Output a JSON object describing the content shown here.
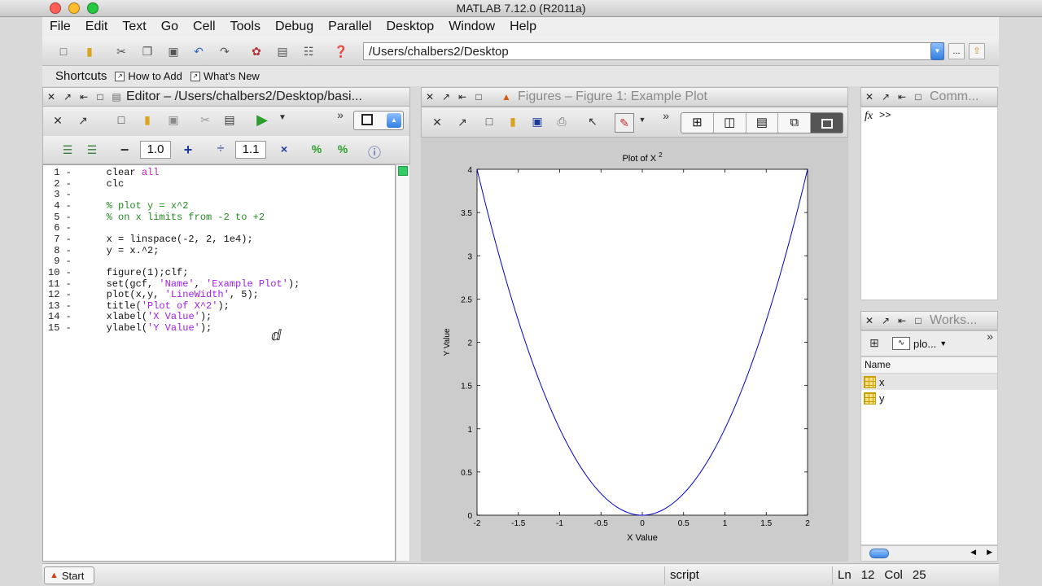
{
  "window": {
    "title": "MATLAB 7.12.0 (R2011a)"
  },
  "menu": [
    "File",
    "Edit",
    "Text",
    "Go",
    "Cell",
    "Tools",
    "Debug",
    "Parallel",
    "Desktop",
    "Window",
    "Help"
  ],
  "toolbar": {
    "current_dir": "/Users/chalbers2/Desktop",
    "browse_label": "..."
  },
  "shortcuts": {
    "label": "Shortcuts",
    "items": [
      "How to Add",
      "What's New"
    ]
  },
  "editor": {
    "title": "Editor – /Users/chalbers2/Desktop/basi...",
    "cell_decrement": "1.0",
    "cell_divide": "1.1",
    "lines": [
      {
        "n": "1",
        "seg": [
          {
            "t": "clear ",
            "c": ""
          },
          {
            "t": "all",
            "c": "kw"
          }
        ]
      },
      {
        "n": "2",
        "seg": [
          {
            "t": "clc",
            "c": ""
          }
        ]
      },
      {
        "n": "3",
        "seg": []
      },
      {
        "n": "4",
        "seg": [
          {
            "t": "% plot y = x^2",
            "c": "cm"
          }
        ]
      },
      {
        "n": "5",
        "seg": [
          {
            "t": "% on x limits from -2 to +2",
            "c": "cm"
          }
        ]
      },
      {
        "n": "6",
        "seg": []
      },
      {
        "n": "7",
        "seg": [
          {
            "t": "x = linspace(-2, 2, 1e4);",
            "c": ""
          }
        ]
      },
      {
        "n": "8",
        "seg": [
          {
            "t": "y = x.^2;",
            "c": ""
          }
        ]
      },
      {
        "n": "9",
        "seg": []
      },
      {
        "n": "10",
        "seg": [
          {
            "t": "figure(1);clf;",
            "c": ""
          }
        ]
      },
      {
        "n": "11",
        "seg": [
          {
            "t": "set(gcf, ",
            "c": ""
          },
          {
            "t": "'Name'",
            "c": "str"
          },
          {
            "t": ", ",
            "c": ""
          },
          {
            "t": "'Example Plot'",
            "c": "str"
          },
          {
            "t": ");",
            "c": ""
          }
        ]
      },
      {
        "n": "12",
        "seg": [
          {
            "t": "plot(x,y, ",
            "c": ""
          },
          {
            "t": "'LineWidth'",
            "c": "str"
          },
          {
            "t": ", 5);",
            "c": ""
          }
        ]
      },
      {
        "n": "13",
        "seg": [
          {
            "t": "title(",
            "c": ""
          },
          {
            "t": "'Plot of X^2'",
            "c": "str"
          },
          {
            "t": ");",
            "c": ""
          }
        ]
      },
      {
        "n": "14",
        "seg": [
          {
            "t": "xlabel(",
            "c": ""
          },
          {
            "t": "'X Value'",
            "c": "str"
          },
          {
            "t": ");",
            "c": ""
          }
        ]
      },
      {
        "n": "15",
        "seg": [
          {
            "t": "ylabel(",
            "c": ""
          },
          {
            "t": "'Y Value'",
            "c": "str"
          },
          {
            "t": ");",
            "c": ""
          }
        ]
      }
    ]
  },
  "figure": {
    "title": "Figures – Figure 1: Example Plot"
  },
  "chart_data": {
    "type": "line",
    "title": "Plot of X",
    "title_superscript": "2",
    "xlabel": "X Value",
    "ylabel": "Y Value",
    "xlim": [
      -2,
      2
    ],
    "ylim": [
      0,
      4
    ],
    "xticks": [
      "-2",
      "-1.5",
      "-1",
      "-0.5",
      "0",
      "0.5",
      "1",
      "1.5",
      "2"
    ],
    "yticks": [
      "0",
      "0.5",
      "1",
      "1.5",
      "2",
      "2.5",
      "3",
      "3.5",
      "4"
    ],
    "series": [
      {
        "x": [
          -2,
          -1.5,
          -1,
          -0.5,
          0,
          0.5,
          1,
          1.5,
          2
        ],
        "y": [
          4,
          2.25,
          1,
          0.25,
          0,
          0.25,
          1,
          2.25,
          4
        ],
        "color": "#0000cc"
      }
    ],
    "grid": false
  },
  "command": {
    "title": "Comm...",
    "prompt_icon": "fx",
    "prompt": ">>"
  },
  "workspace": {
    "title": "Works...",
    "plot_selector": "plo...",
    "column": "Name",
    "vars": [
      "x",
      "y"
    ]
  },
  "status": {
    "start": "Start",
    "mode": "script",
    "ln_label": "Ln",
    "ln": "12",
    "col_label": "Col",
    "col": "25"
  },
  "colors": {
    "accent": "#2f7fe0",
    "comment": "#228b22",
    "string": "#a020f0",
    "plot_line": "#0000cc"
  }
}
